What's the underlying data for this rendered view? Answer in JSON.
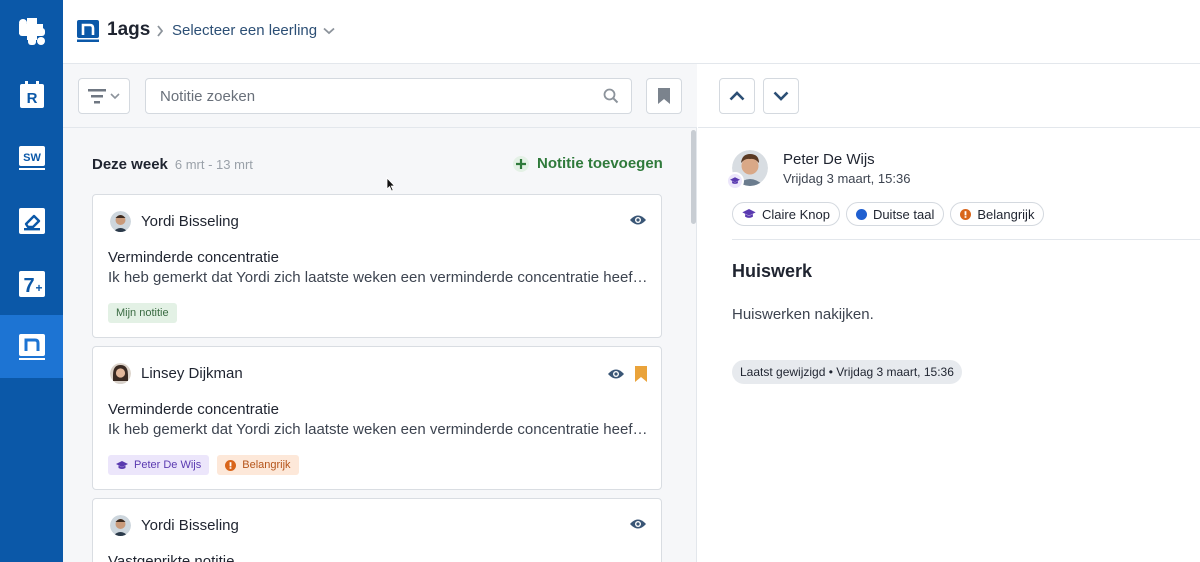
{
  "app": {
    "brand_title": "1ags",
    "student_select": "Selecteer een leerling"
  },
  "rail": {
    "items": [
      {
        "name": "R",
        "icon": "r-app-icon"
      },
      {
        "name": "SW",
        "icon": "sw-app-icon"
      },
      {
        "name": "eraser",
        "icon": "eraser-app-icon"
      },
      {
        "name": "7+",
        "icon": "seven-plus-app-icon"
      },
      {
        "name": "n",
        "icon": "notes-app-icon",
        "active": true
      }
    ]
  },
  "list": {
    "search_placeholder": "Notitie zoeken",
    "week_title": "Deze week",
    "week_range": "6 mrt - 13 mrt",
    "add_note_label": "Notitie toevoegen",
    "notes": [
      {
        "author": "Yordi Bisseling",
        "title": "Verminderde concentratie",
        "body": "Ik heb gemerkt dat Yordi zich laatste weken een verminderde concentratie heeft en het lijkt alsof",
        "tags": [
          "Mijn notitie"
        ],
        "bookmarked": false
      },
      {
        "author": "Linsey Dijkman",
        "title": "Verminderde concentratie",
        "body": "Ik heb gemerkt dat Yordi zich laatste weken een verminderde concentratie heeft en het lijkt alsof",
        "tags": [
          "Peter De Wijs",
          "Belangrijk"
        ],
        "bookmarked": true
      },
      {
        "author": "Yordi Bisseling",
        "title": "Vastgeprikte notitie",
        "bookmarked": false
      }
    ]
  },
  "detail": {
    "author": "Peter De Wijs",
    "date": "Vrijdag 3 maart, 15:36",
    "tags": [
      {
        "label": "Claire Knop",
        "kind": "teacher"
      },
      {
        "label": "Duitse taal",
        "kind": "subject"
      },
      {
        "label": "Belangrijk",
        "kind": "important"
      }
    ],
    "title": "Huiswerk",
    "body": "Huiswerken nakijken.",
    "modified": "Laatst gewijzigd • Vrijdag 3 maart, 15:36"
  },
  "colors": {
    "rail": "#0b58a8",
    "rail_active": "#1d74d3",
    "accent_green": "#2f7a3b",
    "important_orange": "#e0701e",
    "subject_blue": "#1f5fd0",
    "bookmark_gold": "#eaa33a"
  }
}
